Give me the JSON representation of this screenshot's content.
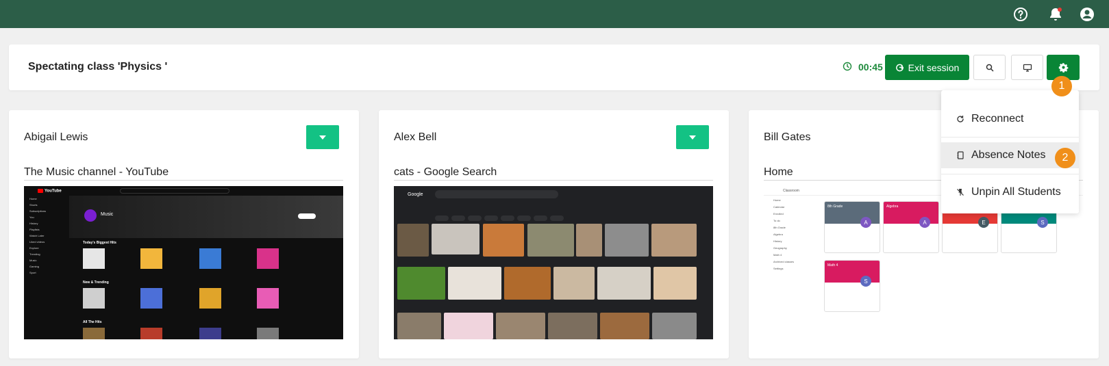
{
  "header": {
    "title": "Spectating class 'Physics '",
    "timer": "00:45",
    "exit_label": "Exit session"
  },
  "topbar": {
    "icons": [
      "help-icon",
      "bell-icon",
      "account-icon"
    ]
  },
  "students": [
    {
      "name": "Abigail Lewis",
      "tab_title": "The Music channel - YouTube"
    },
    {
      "name": "Alex Bell",
      "tab_title": "cats - Google Search"
    },
    {
      "name": "Bill Gates",
      "tab_title": "Home"
    }
  ],
  "dropdown": {
    "items": [
      "Reconnect",
      "Absence Notes",
      "Unpin All Students"
    ]
  },
  "badges": [
    "1",
    "2"
  ],
  "thumbs": {
    "youtube": {
      "logo": "YouTube",
      "channel": "Music",
      "sidebar": [
        "Home",
        "Shorts",
        "Subscriptions",
        "You",
        "History",
        "Playlists",
        "Watch Later",
        "Liked videos",
        "Explore",
        "Trending",
        "Music",
        "Gaming",
        "Sport"
      ],
      "row1": "Today's Biggest Hits",
      "row2": "New & Trending",
      "row3": "All The Hits"
    },
    "google": {
      "logo": "Google",
      "query": "cats"
    },
    "classroom": {
      "title": "Classroom",
      "nav": [
        "Home",
        "Calendar",
        "Enrolled",
        "To do",
        "8th Grade",
        "Algebra",
        "History",
        "Geography",
        "Math 4",
        "Archived classes",
        "Settings"
      ],
      "cards": [
        "8th Grade",
        "Algebra",
        "Math 4"
      ],
      "avatars": [
        "A",
        "A",
        "E",
        "S",
        "S"
      ]
    }
  },
  "colors": {
    "topbar": "#2c5e48",
    "primary_green": "#098536",
    "toggle_green": "#13c284",
    "badge_orange": "#f08f1a",
    "timer_green": "#1e8a3c"
  }
}
